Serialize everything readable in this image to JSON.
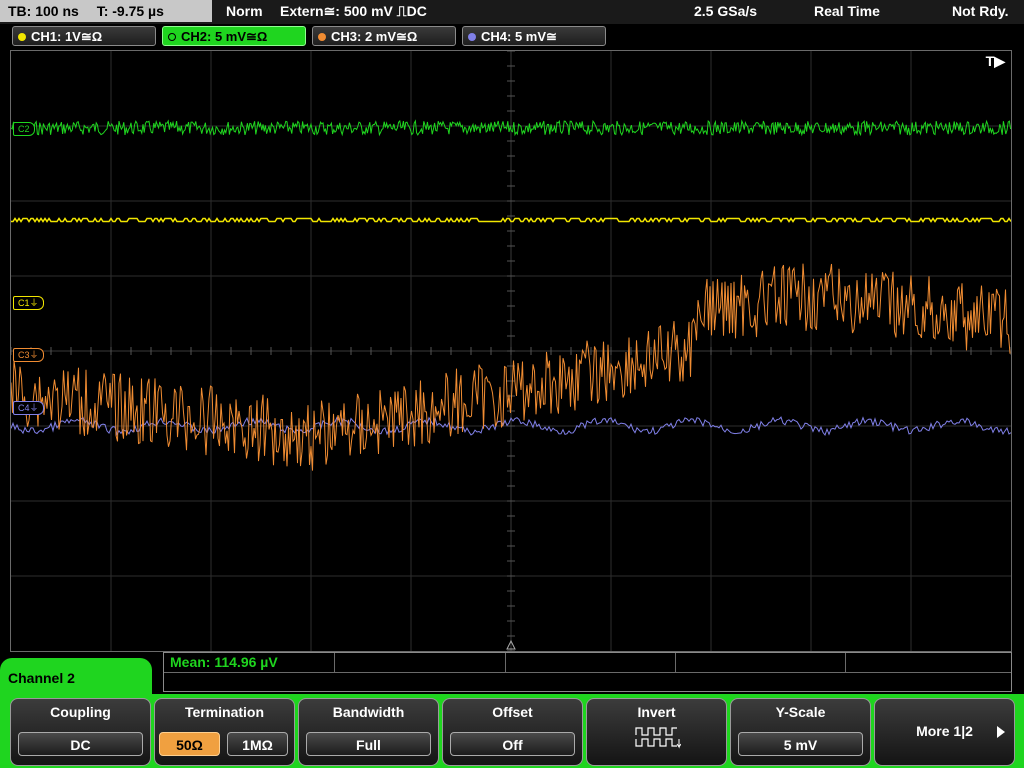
{
  "status": {
    "timebase": "TB: 100 ns",
    "trigger_time": "T: -9.75 µs",
    "mode": "Norm",
    "trigger": "Extern≅: 500 mV ⎍DC",
    "sample_rate": "2.5 GSa/s",
    "acq_mode": "Real Time",
    "ready": "Not Rdy."
  },
  "channels": [
    {
      "label": "CH1: 1V≅Ω",
      "color": "#f2e600",
      "marker": "C1⏚"
    },
    {
      "label": "CH2: 5 mV≅Ω",
      "color": "#1fd51f",
      "marker": "C2"
    },
    {
      "label": "CH3: 2 mV≅Ω",
      "color": "#f08c32",
      "marker": "C3⏚"
    },
    {
      "label": "CH4: 5 mV≅",
      "color": "#8080e8",
      "marker": "C4⏚"
    }
  ],
  "screen": {
    "trigger_marker": "T▶"
  },
  "measurement": {
    "mean": "Mean: 114.96 µV"
  },
  "menu": {
    "title": "Channel 2",
    "coupling": {
      "title": "Coupling",
      "value": "DC"
    },
    "termination": {
      "title": "Termination",
      "options": [
        "50Ω",
        "1MΩ"
      ],
      "selected": "50Ω"
    },
    "bandwidth": {
      "title": "Bandwidth",
      "value": "Full"
    },
    "offset": {
      "title": "Offset",
      "value": "Off"
    },
    "invert": {
      "title": "Invert",
      "icon": "invert-waveform-icon"
    },
    "yscale": {
      "title": "Y-Scale",
      "value": "5 mV"
    },
    "more": {
      "label": "More 1|2",
      "icon": "triangle-right-icon"
    }
  }
}
